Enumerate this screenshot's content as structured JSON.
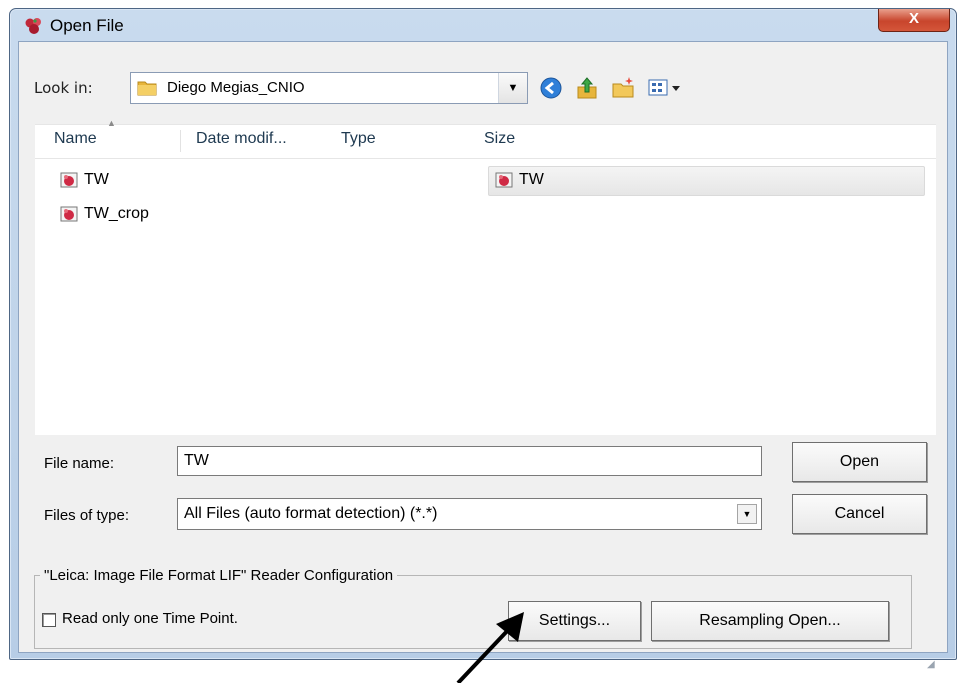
{
  "window": {
    "title": "Open File",
    "close_glyph": "X"
  },
  "lookin": {
    "label": "Look in:",
    "value": "Diego Megias_CNIO"
  },
  "toolbar": {
    "icons": [
      "back-icon",
      "up-folder-icon",
      "new-folder-icon",
      "view-menu-icon"
    ]
  },
  "columns": {
    "name": "Name",
    "date": "Date modif...",
    "type": "Type",
    "size": "Size"
  },
  "files": [
    {
      "label": "TW"
    },
    {
      "label": "TW_crop"
    },
    {
      "label": "TW"
    }
  ],
  "filename": {
    "label": "File name:",
    "value": "TW"
  },
  "filetype": {
    "label": "Files of type:",
    "value": "All Files (auto format detection) (*.*)"
  },
  "buttons": {
    "open": "Open",
    "cancel": "Cancel",
    "settings": "Settings...",
    "resampling": "Resampling Open..."
  },
  "reader": {
    "group_title": "\"Leica: Image File Format LIF\" Reader Configuration",
    "checkbox_label": "Read only one Time Point."
  },
  "colors": {
    "titlebar": "#c9dbee",
    "close": "#c8452c",
    "dialog_bg": "#f0f0f0"
  }
}
